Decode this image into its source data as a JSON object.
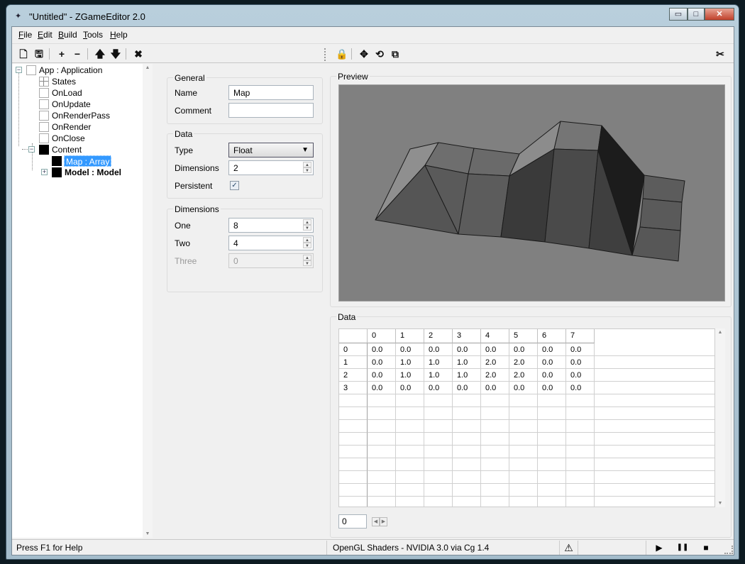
{
  "window": {
    "title": "\"Untitled\" - ZGameEditor 2.0",
    "minimize_glyph": "▭",
    "maximize_glyph": "□",
    "close_glyph": "✕"
  },
  "menu": {
    "items": [
      {
        "accel": "F",
        "rest": "ile"
      },
      {
        "accel": "E",
        "rest": "dit"
      },
      {
        "accel": "B",
        "rest": "uild"
      },
      {
        "accel": "T",
        "rest": "ools"
      },
      {
        "accel": "H",
        "rest": "elp"
      }
    ]
  },
  "toolbar": {
    "new": "🗋",
    "save": "🖫",
    "add": "+",
    "remove": "−",
    "up": "🡅",
    "down": "🡇",
    "delete": "✖",
    "lock": "🔒",
    "move": "✥",
    "rotate": "⟲",
    "popout": "⧉",
    "tools": "✂"
  },
  "tree": {
    "app": "App : Application",
    "states": "States",
    "onload": "OnLoad",
    "onupdate": "OnUpdate",
    "onrenderpass": "OnRenderPass",
    "onrender": "OnRender",
    "onclose": "OnClose",
    "content": "Content",
    "map": "Map : Array",
    "model": "Model : Model",
    "expand_minus": "−",
    "expand_plus": "+"
  },
  "props": {
    "general": {
      "title": "General",
      "name_label": "Name",
      "name_value": "Map",
      "comment_label": "Comment",
      "comment_value": ""
    },
    "data": {
      "title": "Data",
      "type_label": "Type",
      "type_value": "Float",
      "dimensions_label": "Dimensions",
      "dimensions_value": "2",
      "persistent_label": "Persistent",
      "persistent_check": "✓"
    },
    "dims": {
      "title": "Dimensions",
      "one_label": "One",
      "one_value": "8",
      "two_label": "Two",
      "two_value": "4",
      "three_label": "Three",
      "three_value": "0"
    }
  },
  "preview": {
    "title": "Preview"
  },
  "data_grid": {
    "title": "Data",
    "columns": [
      "0",
      "1",
      "2",
      "3",
      "4",
      "5",
      "6",
      "7"
    ],
    "rows": [
      {
        "label": "0",
        "cells": [
          "0.0",
          "0.0",
          "0.0",
          "0.0",
          "0.0",
          "0.0",
          "0.0",
          "0.0"
        ]
      },
      {
        "label": "1",
        "cells": [
          "0.0",
          "1.0",
          "1.0",
          "1.0",
          "2.0",
          "2.0",
          "0.0",
          "0.0"
        ]
      },
      {
        "label": "2",
        "cells": [
          "0.0",
          "1.0",
          "1.0",
          "1.0",
          "2.0",
          "2.0",
          "0.0",
          "0.0"
        ]
      },
      {
        "label": "3",
        "cells": [
          "0.0",
          "0.0",
          "0.0",
          "0.0",
          "0.0",
          "0.0",
          "0.0",
          "0.0"
        ]
      }
    ],
    "index_value": "0"
  },
  "status": {
    "help": "Press F1 for Help",
    "shader": "OpenGL Shaders - NVIDIA 3.0 via Cg 1.4",
    "warning": "⚠",
    "play": "▶",
    "pause": "❚❚",
    "stop": "■"
  }
}
